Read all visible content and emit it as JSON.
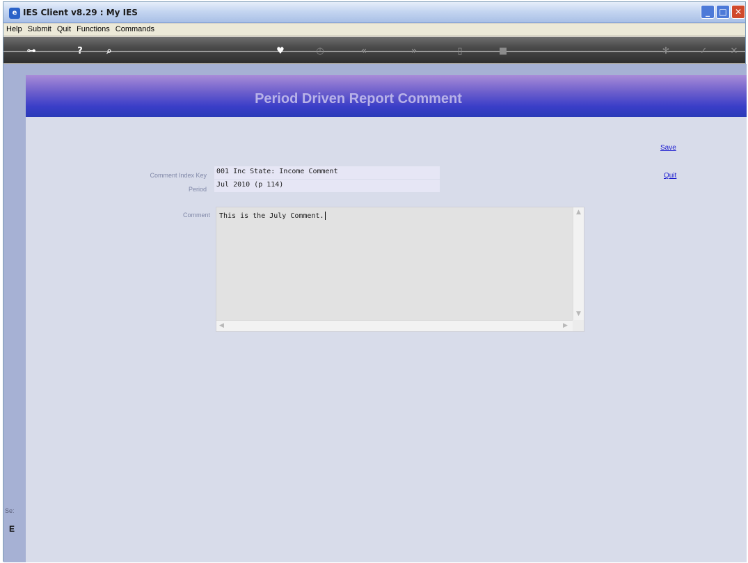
{
  "window": {
    "title": "IES Client v8.29 : My IES",
    "app_icon": "ies-logo-icon"
  },
  "menu": {
    "items": [
      "Help",
      "Submit",
      "Quit",
      "Functions",
      "Commands"
    ]
  },
  "toolbar": {
    "icons": [
      "key-icon",
      "help-icon",
      "search-icon",
      "heart-icon",
      "clock-icon",
      "rewind-icon",
      "forward-icon",
      "document-icon",
      "square-icon",
      "settings-icon",
      "check-icon",
      "close-icon"
    ]
  },
  "page": {
    "title": "Period Driven Report Comment"
  },
  "form": {
    "comment_index_key_label": "Comment Index Key",
    "comment_index_key_value": "001 Inc State: Income Comment",
    "period_label": "Period",
    "period_value": "Jul 2010 (p 114)",
    "comment_label": "Comment",
    "comment_value": "This is the July Comment."
  },
  "actions": {
    "save_label": "Save",
    "quit_label": "Quit"
  },
  "sidebar": {
    "partial_text_1": "Se:",
    "partial_text_2": "E"
  }
}
